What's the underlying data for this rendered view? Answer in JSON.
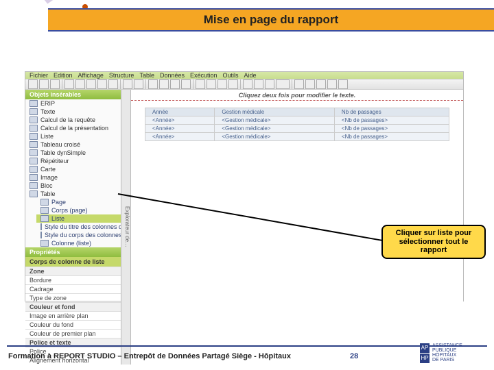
{
  "title": "Mise en page du rapport",
  "menubar": [
    "Fichier",
    "Edition",
    "Affichage",
    "Structure",
    "Table",
    "Données",
    "Exécution",
    "Outils",
    "Aide"
  ],
  "left": {
    "panel1_title": "Objets insérables",
    "items": [
      "ERIP",
      "Texte",
      "Calcul de la requête",
      "Calcul de la présentation",
      "Liste",
      "Tableau croisé",
      "Table dynSimple",
      "Répétiteur",
      "Carte",
      "Image",
      "Bloc",
      "Table"
    ],
    "sub": [
      "Page",
      "Corps (page)",
      "Liste",
      "Style du titre des colonnes de la liste",
      "Style du corps des colonnes de la liste",
      "Colonne (liste)"
    ],
    "panel2_title": "Propriétés",
    "panel2_sub": "Corps de colonne de liste",
    "props_cat1": "Zone",
    "props": [
      "Bordure",
      "Cadrage",
      "Type de zone"
    ],
    "props_cat2": "Couleur et fond",
    "props2": [
      "Image en arrière plan",
      "Couleur du fond",
      "Couleur de premier plan"
    ],
    "props_cat3": "Police et texte",
    "props3": [
      "Police",
      "Alignement horizontal"
    ]
  },
  "canvas": {
    "hint": "Cliquez deux fois pour modifier le texte.",
    "vtab": "Explorateur de…",
    "cols": [
      "Année",
      "Gestion médicale",
      "Nb de passages"
    ],
    "cell": [
      "<Année>",
      "<Gestion médicale>",
      "<Nb de passages>"
    ]
  },
  "callout": "Cliquer sur liste pour sélectionner tout le rapport",
  "footer": {
    "text": "Formation à REPORT STUDIO – Entrepôt de Données Partagé Siège - Hôpitaux",
    "page": "28",
    "logo_lines": [
      "ASSISTANCE",
      "PUBLIQUE",
      "HÔPITAUX",
      "DE PARIS"
    ]
  }
}
